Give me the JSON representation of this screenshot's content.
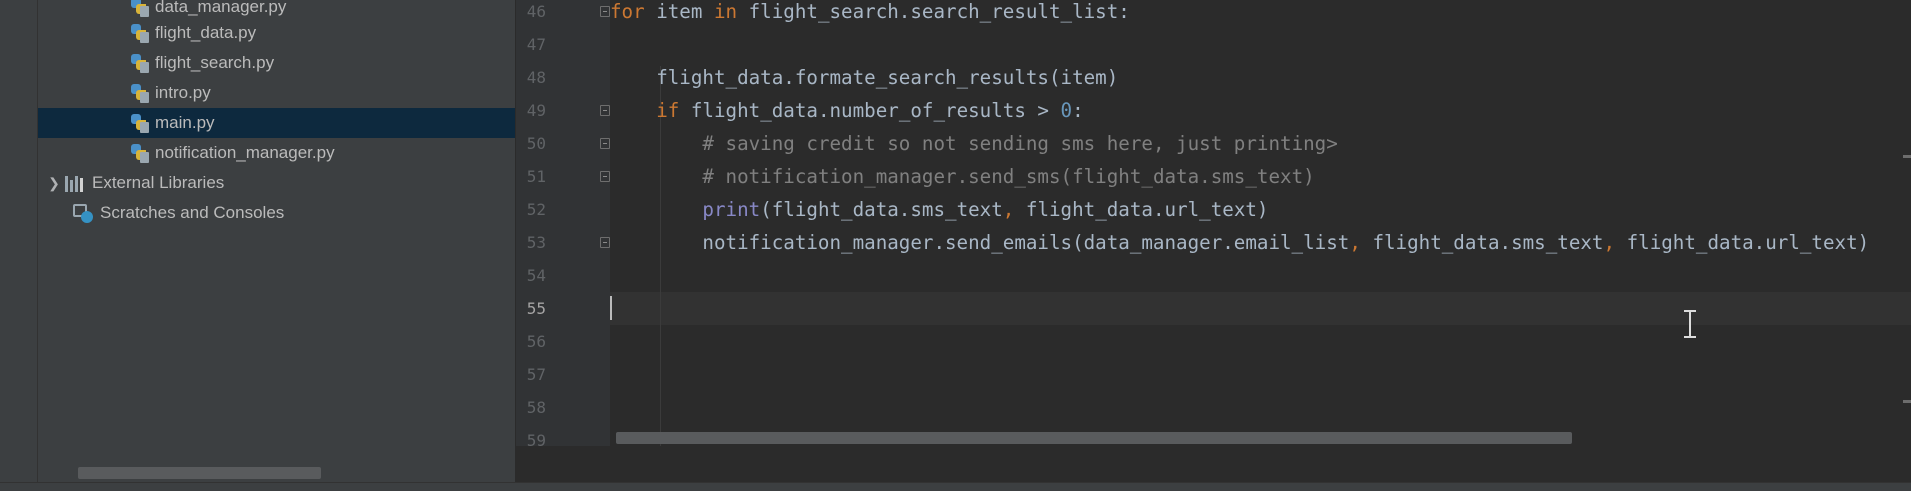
{
  "project_tree": {
    "items": [
      {
        "label": "data_manager.py",
        "kind": "python-file",
        "selected": false
      },
      {
        "label": "flight_data.py",
        "kind": "python-file",
        "selected": false
      },
      {
        "label": "flight_search.py",
        "kind": "python-file",
        "selected": false
      },
      {
        "label": "intro.py",
        "kind": "python-file",
        "selected": false
      },
      {
        "label": "main.py",
        "kind": "python-file",
        "selected": true
      },
      {
        "label": "notification_manager.py",
        "kind": "python-file",
        "selected": false
      },
      {
        "label": "External Libraries",
        "kind": "library-group",
        "selected": false
      },
      {
        "label": "Scratches and Consoles",
        "kind": "scratches",
        "selected": false
      }
    ]
  },
  "editor": {
    "line_numbers": [
      "46",
      "47",
      "48",
      "49",
      "50",
      "51",
      "52",
      "53",
      "54",
      "55",
      "56",
      "57",
      "58",
      "59"
    ],
    "current_line": "55",
    "lines": [
      {
        "number": "46",
        "text": "for item in flight_search.search_result_list:"
      },
      {
        "number": "47",
        "text": ""
      },
      {
        "number": "48",
        "text": "    flight_data.formate_search_results(item)"
      },
      {
        "number": "49",
        "text": "    if flight_data.number_of_results > 0:"
      },
      {
        "number": "50",
        "text": "        # saving credit so not sending sms here, just printing>"
      },
      {
        "number": "51",
        "text": "        # notification_manager.send_sms(flight_data.sms_text)"
      },
      {
        "number": "52",
        "text": "        print(flight_data.sms_text, flight_data.url_text)"
      },
      {
        "number": "53",
        "text": "        notification_manager.send_emails(data_manager.email_list, flight_data.sms_text, flight_data.url_text)"
      },
      {
        "number": "54",
        "text": ""
      },
      {
        "number": "55",
        "text": ""
      },
      {
        "number": "56",
        "text": ""
      },
      {
        "number": "57",
        "text": ""
      },
      {
        "number": "58",
        "text": ""
      },
      {
        "number": "59",
        "text": ""
      }
    ]
  },
  "colors": {
    "keyword": "#cc7832",
    "number": "#6897bb",
    "comment": "#808080",
    "builtin": "#8888c6",
    "default_text": "#a9b7c6",
    "selection": "#0d293e",
    "background": "#2b2b2b"
  }
}
